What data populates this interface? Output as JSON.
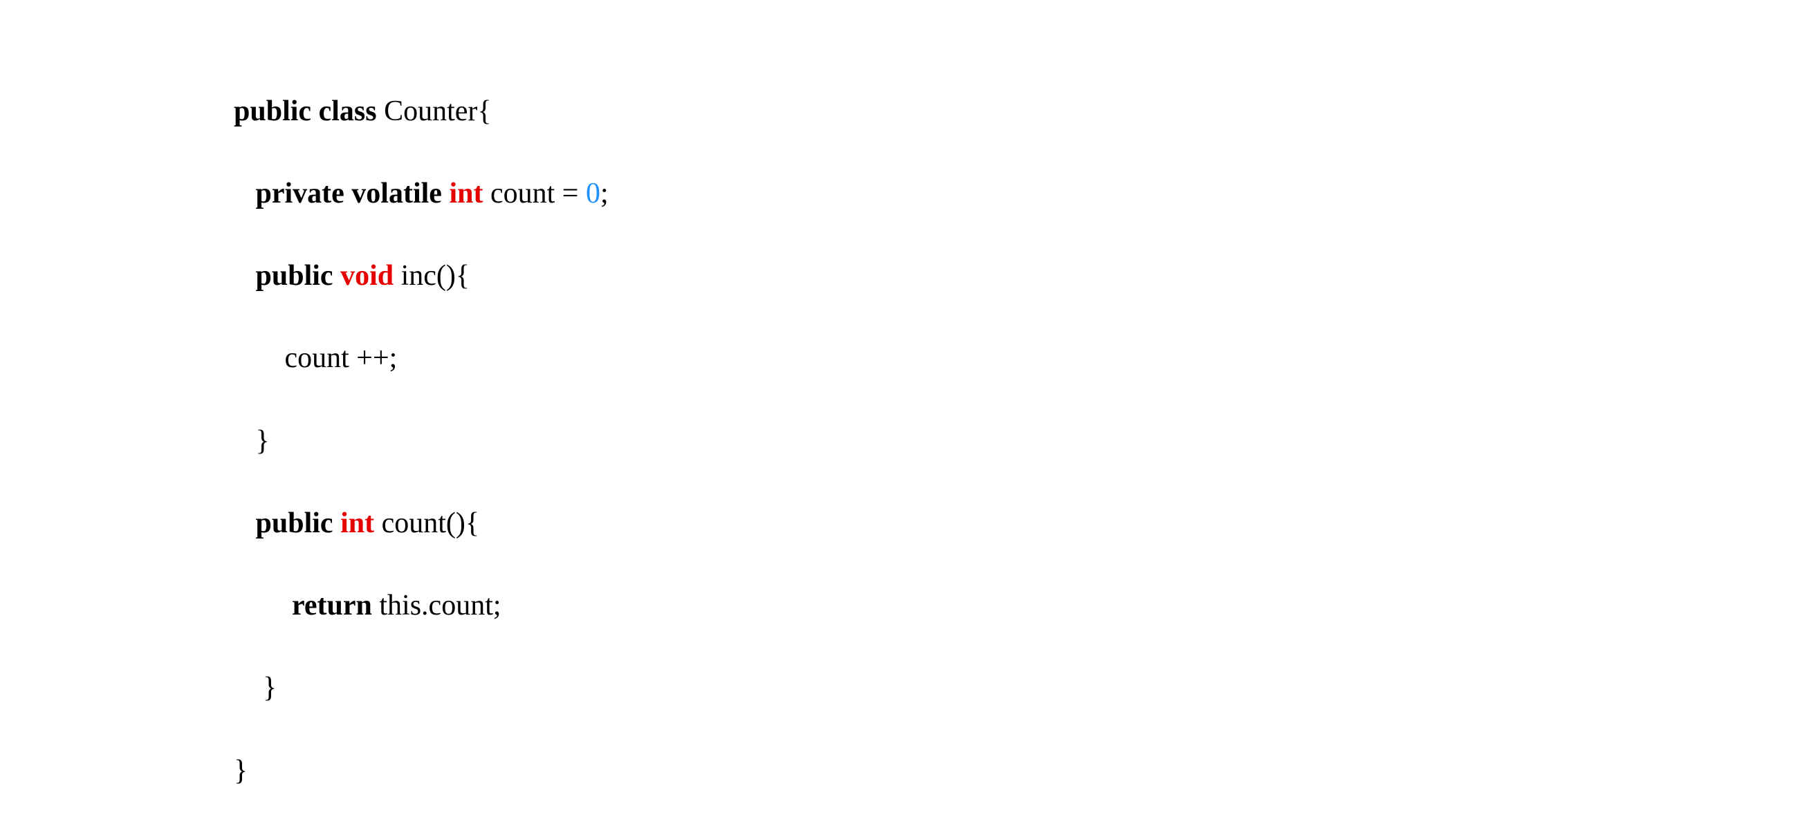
{
  "code": {
    "line1": {
      "kw_public": "public",
      "kw_class": "class",
      "name": "Counter",
      "brace": "{"
    },
    "line2": {
      "kw_private": "private",
      "kw_volatile": "volatile",
      "type_int": "int",
      "var": "count",
      "eq": "=",
      "zero": "0",
      "semi": ";"
    },
    "line3": {
      "kw_public": "public",
      "type_void": "void",
      "method": "inc",
      "paren_brace": "(){"
    },
    "line4": {
      "stmt": "count ++;"
    },
    "line5": {
      "brace": "}"
    },
    "line6": {
      "kw_public": "public",
      "type_int": "int",
      "method": "count",
      "paren_brace": "(){"
    },
    "line7": {
      "kw_return": "return",
      "expr": "this.count;"
    },
    "line8": {
      "brace": "}"
    },
    "line9": {
      "brace": "}"
    }
  }
}
